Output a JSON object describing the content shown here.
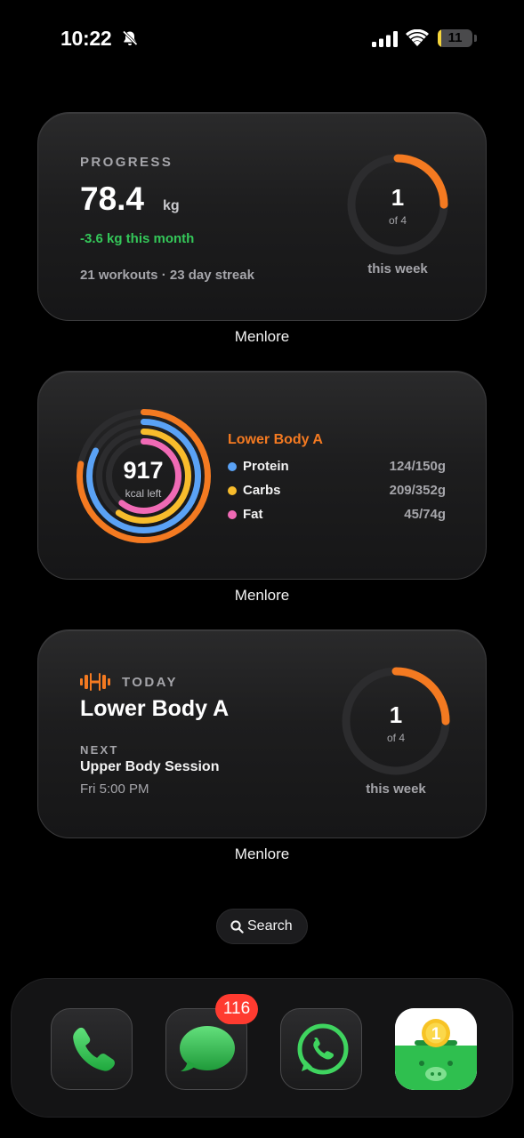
{
  "status_bar": {
    "time": "10:22",
    "battery_level": "11",
    "battery_fraction": 0.11,
    "icons": [
      "bell-slash-icon",
      "cellular-signal-icon",
      "wifi-icon",
      "battery-icon"
    ]
  },
  "widgets": [
    {
      "caption": "Menlore",
      "eyebrow": "PROGRESS",
      "weight_value": "78.4",
      "weight_unit": "kg",
      "delta": "-3.6 kg this month",
      "stats": "21 workouts · 23 day streak",
      "ring": {
        "count": "1",
        "of": "of 4",
        "caption": "this week",
        "fraction": 0.25
      }
    },
    {
      "caption": "Menlore",
      "title": "Lower Body A",
      "kcal_value": "917",
      "kcal_label": "kcal left",
      "macros": [
        {
          "name": "Protein",
          "value": "124/150g",
          "color": "#5aa2f5",
          "fraction": 0.827
        },
        {
          "name": "Carbs",
          "value": "209/352g",
          "color": "#f8bc2c",
          "fraction": 0.594
        },
        {
          "name": "Fat",
          "value": "45/74g",
          "color": "#f06ab5",
          "fraction": 0.608
        }
      ],
      "calorie_ring_color": "#f47a21",
      "calorie_ring_fraction": 0.78
    },
    {
      "caption": "Menlore",
      "eyebrow": "TODAY",
      "workout": "Lower Body A",
      "next_label": "NEXT",
      "next_name": "Upper Body Session",
      "next_time": "Fri 5:00 PM",
      "ring": {
        "count": "1",
        "of": "of 4",
        "caption": "this week",
        "fraction": 0.25
      }
    }
  ],
  "search": {
    "label": "Search",
    "icon": "magnifier-icon"
  },
  "dock": {
    "apps": [
      {
        "name": "Phone",
        "icon": "phone-icon"
      },
      {
        "name": "Messages",
        "icon": "messages-icon",
        "badge": "116"
      },
      {
        "name": "WhatsApp",
        "icon": "whatsapp-icon"
      },
      {
        "name": "Money Manager",
        "icon": "piggy-bank-coin-icon",
        "coin_text": "1"
      }
    ]
  },
  "colors": {
    "accent": "#f47a21",
    "positive": "#34c759",
    "badge": "#ff3b30",
    "ring_track": "#2c2c2e"
  }
}
